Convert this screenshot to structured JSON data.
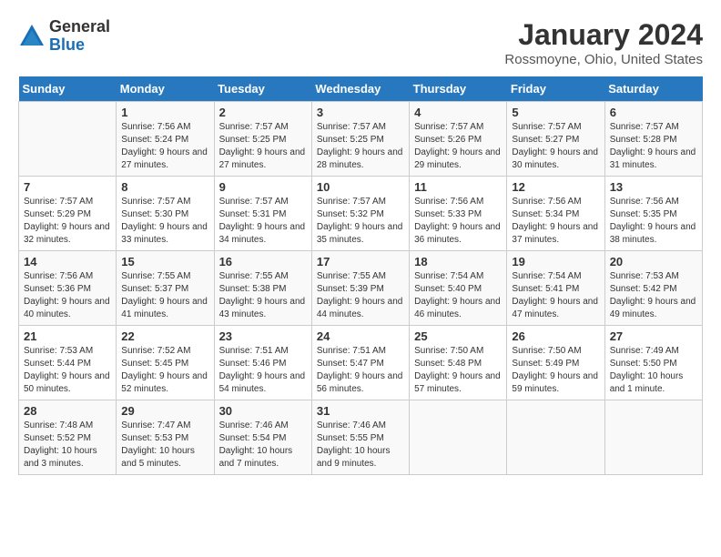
{
  "header": {
    "logo_general": "General",
    "logo_blue": "Blue",
    "month_title": "January 2024",
    "location": "Rossmoyne, Ohio, United States"
  },
  "days_of_week": [
    "Sunday",
    "Monday",
    "Tuesday",
    "Wednesday",
    "Thursday",
    "Friday",
    "Saturday"
  ],
  "weeks": [
    [
      {
        "day": "",
        "sunrise": "",
        "sunset": "",
        "daylight": ""
      },
      {
        "day": "1",
        "sunrise": "Sunrise: 7:56 AM",
        "sunset": "Sunset: 5:24 PM",
        "daylight": "Daylight: 9 hours and 27 minutes."
      },
      {
        "day": "2",
        "sunrise": "Sunrise: 7:57 AM",
        "sunset": "Sunset: 5:25 PM",
        "daylight": "Daylight: 9 hours and 27 minutes."
      },
      {
        "day": "3",
        "sunrise": "Sunrise: 7:57 AM",
        "sunset": "Sunset: 5:25 PM",
        "daylight": "Daylight: 9 hours and 28 minutes."
      },
      {
        "day": "4",
        "sunrise": "Sunrise: 7:57 AM",
        "sunset": "Sunset: 5:26 PM",
        "daylight": "Daylight: 9 hours and 29 minutes."
      },
      {
        "day": "5",
        "sunrise": "Sunrise: 7:57 AM",
        "sunset": "Sunset: 5:27 PM",
        "daylight": "Daylight: 9 hours and 30 minutes."
      },
      {
        "day": "6",
        "sunrise": "Sunrise: 7:57 AM",
        "sunset": "Sunset: 5:28 PM",
        "daylight": "Daylight: 9 hours and 31 minutes."
      }
    ],
    [
      {
        "day": "7",
        "sunrise": "Sunrise: 7:57 AM",
        "sunset": "Sunset: 5:29 PM",
        "daylight": "Daylight: 9 hours and 32 minutes."
      },
      {
        "day": "8",
        "sunrise": "Sunrise: 7:57 AM",
        "sunset": "Sunset: 5:30 PM",
        "daylight": "Daylight: 9 hours and 33 minutes."
      },
      {
        "day": "9",
        "sunrise": "Sunrise: 7:57 AM",
        "sunset": "Sunset: 5:31 PM",
        "daylight": "Daylight: 9 hours and 34 minutes."
      },
      {
        "day": "10",
        "sunrise": "Sunrise: 7:57 AM",
        "sunset": "Sunset: 5:32 PM",
        "daylight": "Daylight: 9 hours and 35 minutes."
      },
      {
        "day": "11",
        "sunrise": "Sunrise: 7:56 AM",
        "sunset": "Sunset: 5:33 PM",
        "daylight": "Daylight: 9 hours and 36 minutes."
      },
      {
        "day": "12",
        "sunrise": "Sunrise: 7:56 AM",
        "sunset": "Sunset: 5:34 PM",
        "daylight": "Daylight: 9 hours and 37 minutes."
      },
      {
        "day": "13",
        "sunrise": "Sunrise: 7:56 AM",
        "sunset": "Sunset: 5:35 PM",
        "daylight": "Daylight: 9 hours and 38 minutes."
      }
    ],
    [
      {
        "day": "14",
        "sunrise": "Sunrise: 7:56 AM",
        "sunset": "Sunset: 5:36 PM",
        "daylight": "Daylight: 9 hours and 40 minutes."
      },
      {
        "day": "15",
        "sunrise": "Sunrise: 7:55 AM",
        "sunset": "Sunset: 5:37 PM",
        "daylight": "Daylight: 9 hours and 41 minutes."
      },
      {
        "day": "16",
        "sunrise": "Sunrise: 7:55 AM",
        "sunset": "Sunset: 5:38 PM",
        "daylight": "Daylight: 9 hours and 43 minutes."
      },
      {
        "day": "17",
        "sunrise": "Sunrise: 7:55 AM",
        "sunset": "Sunset: 5:39 PM",
        "daylight": "Daylight: 9 hours and 44 minutes."
      },
      {
        "day": "18",
        "sunrise": "Sunrise: 7:54 AM",
        "sunset": "Sunset: 5:40 PM",
        "daylight": "Daylight: 9 hours and 46 minutes."
      },
      {
        "day": "19",
        "sunrise": "Sunrise: 7:54 AM",
        "sunset": "Sunset: 5:41 PM",
        "daylight": "Daylight: 9 hours and 47 minutes."
      },
      {
        "day": "20",
        "sunrise": "Sunrise: 7:53 AM",
        "sunset": "Sunset: 5:42 PM",
        "daylight": "Daylight: 9 hours and 49 minutes."
      }
    ],
    [
      {
        "day": "21",
        "sunrise": "Sunrise: 7:53 AM",
        "sunset": "Sunset: 5:44 PM",
        "daylight": "Daylight: 9 hours and 50 minutes."
      },
      {
        "day": "22",
        "sunrise": "Sunrise: 7:52 AM",
        "sunset": "Sunset: 5:45 PM",
        "daylight": "Daylight: 9 hours and 52 minutes."
      },
      {
        "day": "23",
        "sunrise": "Sunrise: 7:51 AM",
        "sunset": "Sunset: 5:46 PM",
        "daylight": "Daylight: 9 hours and 54 minutes."
      },
      {
        "day": "24",
        "sunrise": "Sunrise: 7:51 AM",
        "sunset": "Sunset: 5:47 PM",
        "daylight": "Daylight: 9 hours and 56 minutes."
      },
      {
        "day": "25",
        "sunrise": "Sunrise: 7:50 AM",
        "sunset": "Sunset: 5:48 PM",
        "daylight": "Daylight: 9 hours and 57 minutes."
      },
      {
        "day": "26",
        "sunrise": "Sunrise: 7:50 AM",
        "sunset": "Sunset: 5:49 PM",
        "daylight": "Daylight: 9 hours and 59 minutes."
      },
      {
        "day": "27",
        "sunrise": "Sunrise: 7:49 AM",
        "sunset": "Sunset: 5:50 PM",
        "daylight": "Daylight: 10 hours and 1 minute."
      }
    ],
    [
      {
        "day": "28",
        "sunrise": "Sunrise: 7:48 AM",
        "sunset": "Sunset: 5:52 PM",
        "daylight": "Daylight: 10 hours and 3 minutes."
      },
      {
        "day": "29",
        "sunrise": "Sunrise: 7:47 AM",
        "sunset": "Sunset: 5:53 PM",
        "daylight": "Daylight: 10 hours and 5 minutes."
      },
      {
        "day": "30",
        "sunrise": "Sunrise: 7:46 AM",
        "sunset": "Sunset: 5:54 PM",
        "daylight": "Daylight: 10 hours and 7 minutes."
      },
      {
        "day": "31",
        "sunrise": "Sunrise: 7:46 AM",
        "sunset": "Sunset: 5:55 PM",
        "daylight": "Daylight: 10 hours and 9 minutes."
      },
      {
        "day": "",
        "sunrise": "",
        "sunset": "",
        "daylight": ""
      },
      {
        "day": "",
        "sunrise": "",
        "sunset": "",
        "daylight": ""
      },
      {
        "day": "",
        "sunrise": "",
        "sunset": "",
        "daylight": ""
      }
    ]
  ]
}
